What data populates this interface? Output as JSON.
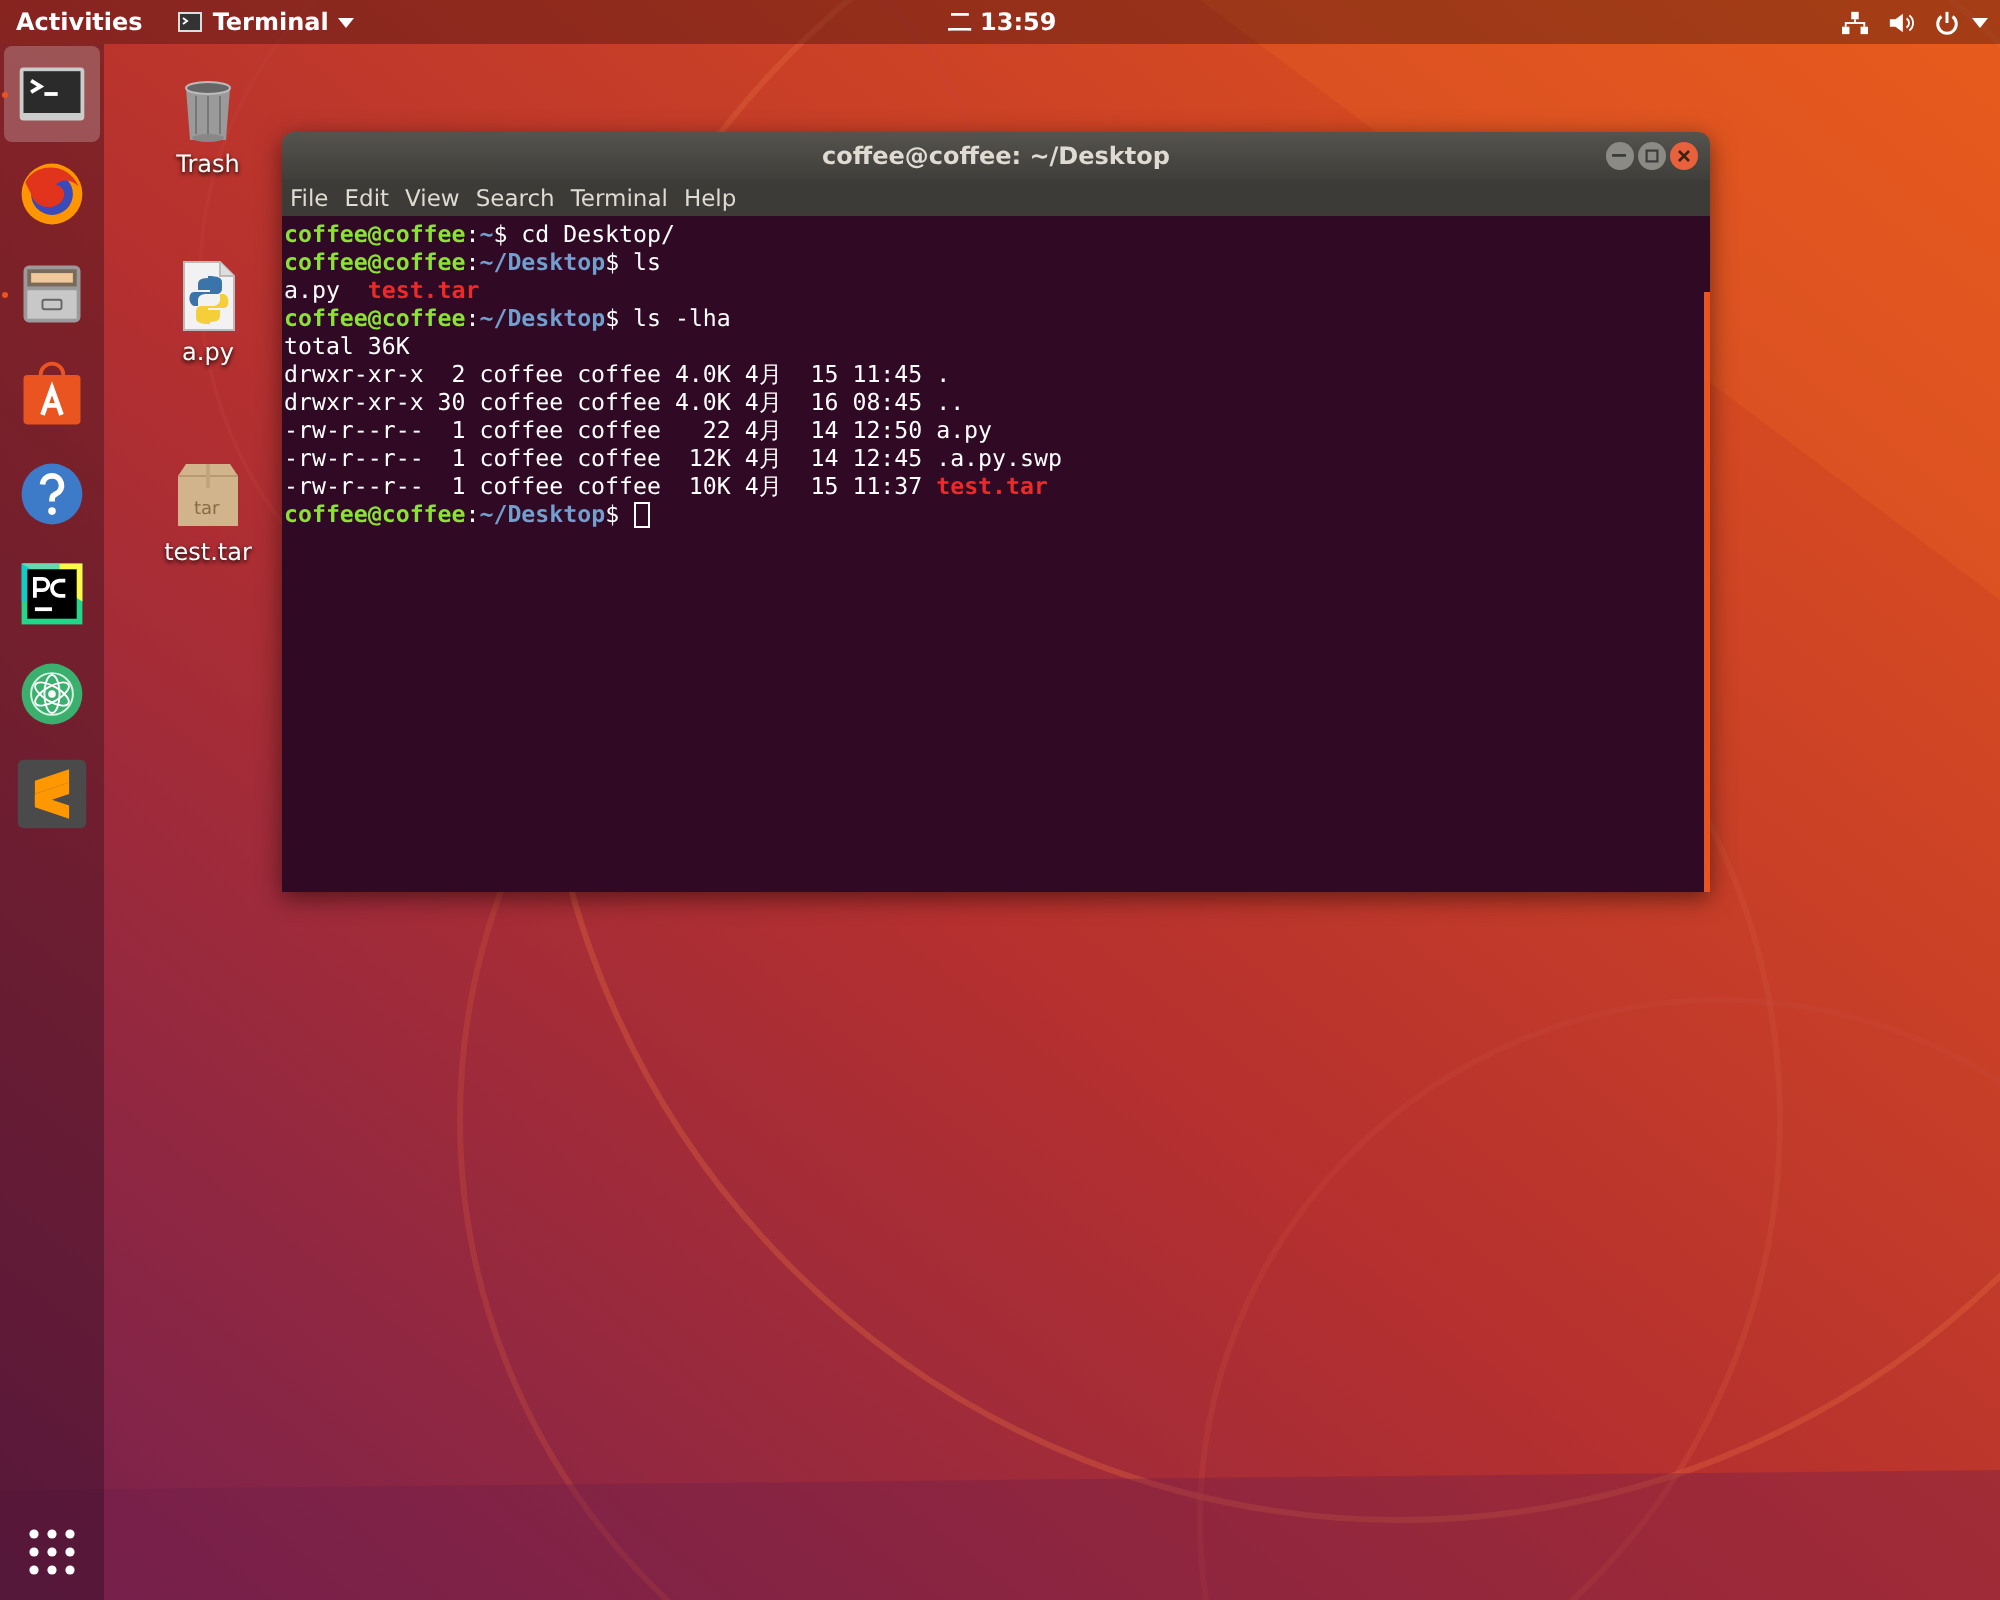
{
  "top_bar": {
    "activities": "Activities",
    "app_menu": "Terminal",
    "clock": "二 13:59"
  },
  "dock": {
    "items": [
      {
        "kind": "terminal",
        "selected": true,
        "running": true
      },
      {
        "kind": "firefox",
        "selected": false,
        "running": false
      },
      {
        "kind": "files",
        "selected": false,
        "running": true
      },
      {
        "kind": "software",
        "selected": false,
        "running": false
      },
      {
        "kind": "help",
        "selected": false,
        "running": false
      },
      {
        "kind": "pycharm",
        "selected": false,
        "running": false
      },
      {
        "kind": "atom",
        "selected": false,
        "running": false
      },
      {
        "kind": "sublime",
        "selected": false,
        "running": false
      }
    ]
  },
  "desktop_icons": [
    {
      "kind": "trash",
      "label": "Trash"
    },
    {
      "kind": "python",
      "label": "a.py"
    },
    {
      "kind": "archive",
      "label": "test.tar",
      "badge": "tar"
    }
  ],
  "window": {
    "title": "coffee@coffee: ~/Desktop",
    "menu": [
      "File",
      "Edit",
      "View",
      "Search",
      "Terminal",
      "Help"
    ],
    "lines": [
      {
        "segments": [
          {
            "kind": "user",
            "text": "coffee@coffee"
          },
          {
            "kind": "plain",
            "text": ":"
          },
          {
            "kind": "path",
            "text": "~"
          },
          {
            "kind": "plain",
            "text": "$ cd Desktop/"
          }
        ]
      },
      {
        "segments": [
          {
            "kind": "user",
            "text": "coffee@coffee"
          },
          {
            "kind": "plain",
            "text": ":"
          },
          {
            "kind": "path",
            "text": "~/Desktop"
          },
          {
            "kind": "plain",
            "text": "$ ls"
          }
        ]
      },
      {
        "segments": [
          {
            "kind": "plain",
            "text": "a.py  "
          },
          {
            "kind": "archive",
            "text": "test.tar"
          }
        ]
      },
      {
        "segments": [
          {
            "kind": "user",
            "text": "coffee@coffee"
          },
          {
            "kind": "plain",
            "text": ":"
          },
          {
            "kind": "path",
            "text": "~/Desktop"
          },
          {
            "kind": "plain",
            "text": "$ ls -lha"
          }
        ]
      },
      {
        "segments": [
          {
            "kind": "plain",
            "text": "total 36K"
          }
        ]
      },
      {
        "segments": [
          {
            "kind": "plain",
            "text": "drwxr-xr-x  2 coffee coffee 4.0K 4月  15 11:45 ."
          }
        ]
      },
      {
        "segments": [
          {
            "kind": "plain",
            "text": "drwxr-xr-x 30 coffee coffee 4.0K 4月  16 08:45 .."
          }
        ]
      },
      {
        "segments": [
          {
            "kind": "plain",
            "text": "-rw-r--r--  1 coffee coffee   22 4月  14 12:50 a.py"
          }
        ]
      },
      {
        "segments": [
          {
            "kind": "plain",
            "text": "-rw-r--r--  1 coffee coffee  12K 4月  14 12:45 .a.py.swp"
          }
        ]
      },
      {
        "segments": [
          {
            "kind": "plain",
            "text": "-rw-r--r--  1 coffee coffee  10K 4月  15 11:37 "
          },
          {
            "kind": "archive",
            "text": "test.tar"
          }
        ]
      },
      {
        "segments": [
          {
            "kind": "user",
            "text": "coffee@coffee"
          },
          {
            "kind": "plain",
            "text": ":"
          },
          {
            "kind": "path",
            "text": "~/Desktop"
          },
          {
            "kind": "plain",
            "text": "$ "
          }
        ],
        "cursor": true
      }
    ]
  }
}
